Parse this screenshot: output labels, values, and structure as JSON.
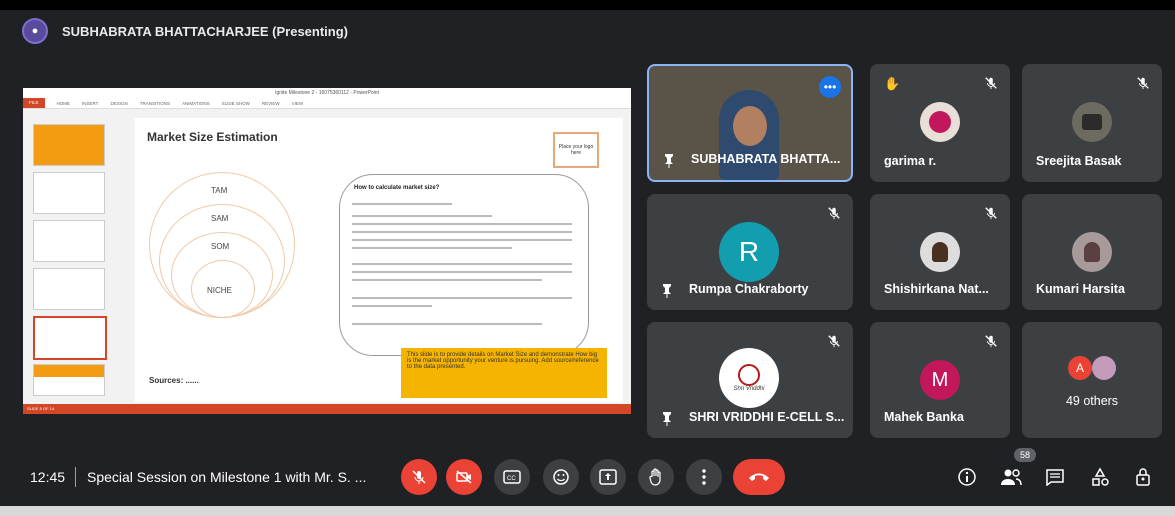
{
  "presenter": {
    "title": "SUBHABRATA BHATTACHARJEE (Presenting)"
  },
  "slide": {
    "window_title": "Ignite Milestone 2 - 16075360112 - PowerPoint",
    "ribbon": [
      "FILE",
      "HOME",
      "INSERT",
      "DESIGN",
      "TRANSITIONS",
      "ANIMATIONS",
      "SLIDE SHOW",
      "REVIEW",
      "VIEW"
    ],
    "title": "Market Size Estimation",
    "logo_box": "Place your logo here",
    "circles": [
      "TAM",
      "SAM",
      "SOM",
      "NICHE"
    ],
    "calc_title": "How to calculate market size?",
    "note": "This slide is to provide details on Market Size and demonstrate How big is the market opportunity your venture is pursuing. Add source/reference to the data presented.",
    "sources": "Sources: ......",
    "status": "SLIDE 5 OF 14"
  },
  "participants": [
    {
      "name": "SUBHABRATA BHATTA...",
      "type": "video"
    },
    {
      "name": "garima r.",
      "type": "image"
    },
    {
      "name": "Sreejita Basak",
      "type": "image"
    },
    {
      "name": "Rumpa Chakraborty",
      "type": "letter",
      "letter": "R",
      "color": "#129eaf"
    },
    {
      "name": "Shishirkana Nat...",
      "type": "image"
    },
    {
      "name": "Kumari Harsita",
      "type": "image"
    },
    {
      "name": "SHRI VRIDDHI E-CELL S...",
      "type": "logo",
      "logo_text": "Shri Vriddhi"
    },
    {
      "name": "Mahek Banka",
      "type": "letter",
      "letter": "M",
      "color": "#c2185b"
    },
    {
      "name": "49 others",
      "type": "others",
      "letter": "A"
    }
  ],
  "bottombar": {
    "time": "12:45",
    "meeting": "Special Session on Milestone 1 with Mr. S. ...",
    "participant_count": "58"
  },
  "colors": {
    "bg": "#202124",
    "tile": "#3c4043",
    "red": "#ea4335",
    "blue": "#8ab4f8"
  }
}
